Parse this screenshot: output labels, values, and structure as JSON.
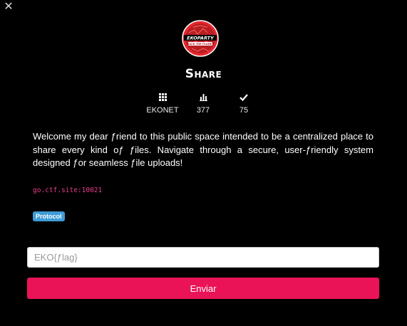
{
  "header": {
    "close_glyph": "✕",
    "logo_text": "EKOPARTY",
    "logo_subtext": "HACK THE PLANET",
    "title": "Share"
  },
  "stats": [
    {
      "icon": "grid-icon",
      "value": "EKONET"
    },
    {
      "icon": "bar-chart-icon",
      "value": "377"
    },
    {
      "icon": "check-icon",
      "value": "75"
    }
  ],
  "description": "Welcome my dear ƒriend to this public space intended to be a centralized place to share every kind oƒ ƒiles. Navigate through a secure, user-ƒriendly system designed ƒor seamless ƒile uploads!",
  "host": "go.ctf.site:10021",
  "badge": "Protocol",
  "form": {
    "placeholder": "EKO{ƒlag}",
    "submit_label": "Enviar"
  },
  "colors": {
    "background": "#000000",
    "accent": "#ea1358",
    "badge": "#3f9bd6",
    "code": "#e83e8c"
  }
}
